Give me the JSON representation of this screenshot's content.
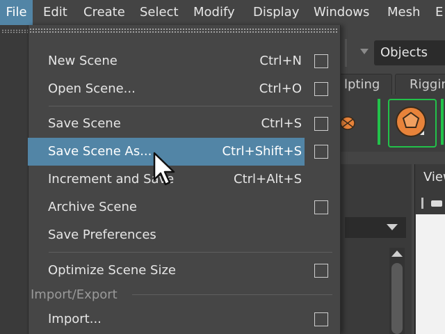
{
  "menubar": {
    "items": [
      "File",
      "Edit",
      "Create",
      "Select",
      "Modify",
      "Display",
      "Windows",
      "Mesh",
      "E"
    ]
  },
  "toolbar": {
    "selection_mode": "Objects"
  },
  "shelf": {
    "tabs": [
      "lpting",
      "Riggin"
    ]
  },
  "view_panel": {
    "title": "View"
  },
  "file_menu": {
    "items": [
      {
        "label": "New Scene",
        "shortcut": "Ctrl+N",
        "has_options": true
      },
      {
        "label": "Open Scene...",
        "shortcut": "Ctrl+O",
        "has_options": true
      },
      {
        "label": "Save Scene",
        "shortcut": "Ctrl+S",
        "has_options": true
      },
      {
        "label": "Save Scene As...",
        "shortcut": "Ctrl+Shift+S",
        "has_options": true
      },
      {
        "label": "Increment and Save",
        "shortcut": "Ctrl+Alt+S",
        "has_options": false
      },
      {
        "label": "Archive Scene",
        "shortcut": "",
        "has_options": true
      },
      {
        "label": "Save Preferences",
        "shortcut": "",
        "has_options": false
      },
      {
        "label": "Optimize Scene Size",
        "shortcut": "",
        "has_options": true
      },
      {
        "label": "Import...",
        "shortcut": "",
        "has_options": true
      }
    ],
    "section_import_export": "Import/Export",
    "highlighted": "Save Scene As..."
  },
  "colors": {
    "highlight": "#5285a6",
    "background": "#444444",
    "accent_green": "#22c24a",
    "icon_orange": "#e8833a"
  }
}
